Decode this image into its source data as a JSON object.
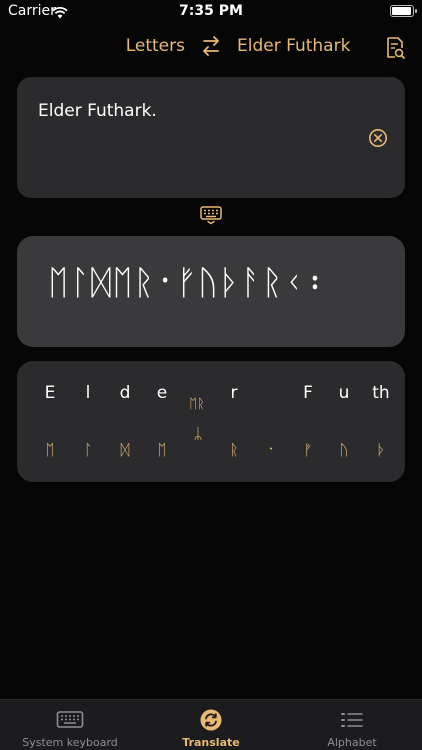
{
  "status": {
    "carrier": "Carrier",
    "time": "7:35 PM",
    "battery_level": 1.0
  },
  "header": {
    "from_lang": "Letters",
    "to_lang": "Elder Futhark"
  },
  "input": {
    "text": "Elder Futhark."
  },
  "output": {
    "text": "ᛖᛚᛞᛖᚱ᛫ᚠᚢᚦᚨᚱᚲ᛬"
  },
  "breakdown": {
    "latin": [
      "E",
      "l",
      "d",
      "e",
      "r",
      "F",
      "u",
      "th"
    ],
    "runes": [
      "ᛖ",
      "ᛚ",
      "ᛞ",
      "ᛖ",
      "ᚱ",
      "᛫",
      "ᚠ",
      "ᚢ",
      "ᚦ"
    ],
    "ligature": "ᛖᚱ",
    "y_rune": "ᛦ"
  },
  "tabs": [
    {
      "label": "System keyboard",
      "icon": "keyboard-icon"
    },
    {
      "label": "Translate",
      "icon": "translate-icon"
    },
    {
      "label": "Alphabet",
      "icon": "list-icon"
    }
  ],
  "colors": {
    "accent": "#e8b972",
    "card": "#2b2b2e",
    "card_output": "#3a3a3c",
    "background": "#060606"
  }
}
